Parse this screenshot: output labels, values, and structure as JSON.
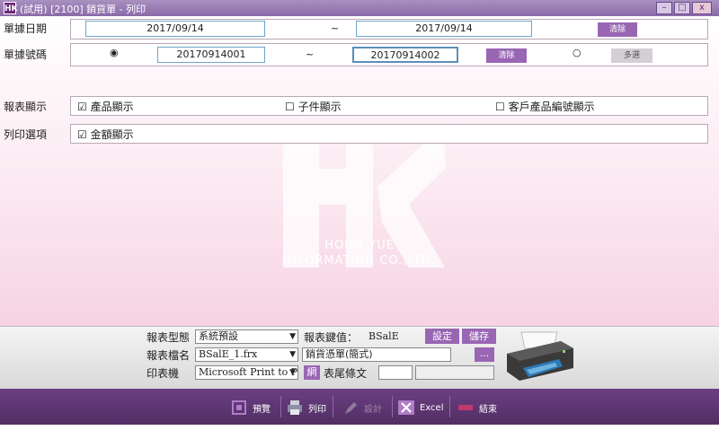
{
  "window": {
    "logo": "HK",
    "title": "(試用) [2100] 銷貨單 - 列印",
    "buttons": {
      "minimize": "–",
      "maximize": "□",
      "close": "x"
    }
  },
  "date_row": {
    "label": "單據日期",
    "from": "2017/09/14",
    "separator": "~",
    "to": "2017/09/14",
    "clear_label": "清除"
  },
  "number_row": {
    "label": "單據號碼",
    "radio_range": "◉",
    "from": "20170914001",
    "separator": "~",
    "to": "20170914002",
    "clear_label": "清除",
    "radio_multi": "○",
    "multi_label": "多選"
  },
  "display_row": {
    "label": "報表顯示",
    "options": [
      {
        "mark": "☑",
        "text": "產品顯示"
      },
      {
        "mark": "☐",
        "text": "子件顯示"
      },
      {
        "mark": "☐",
        "text": "客戶產品編號顯示"
      }
    ]
  },
  "print_row": {
    "label": "列印選項",
    "options": [
      {
        "mark": "☑",
        "text": "金額顯示"
      }
    ]
  },
  "watermark": {
    "line1": "HONG YUE",
    "line2": "INFORMATION CO.,LTD."
  },
  "settings": {
    "report_type_label": "報表型態",
    "report_type_value": "系統預設",
    "report_key_label": "報表鍵值：",
    "report_key_value": "BSalE",
    "setup_button": "設定",
    "save_button": "儲存",
    "report_file_label": "報表檔名",
    "report_file_value": "BSalE_1.frx",
    "report_name_value": "銷貨憑單(簡式)",
    "browse_button": "...",
    "printer_label": "印表機",
    "printer_value": "Microsoft Print to PI",
    "net_button": "網",
    "footer_text_label": "表尾條文"
  },
  "toolbar": {
    "preview": "預覽",
    "print": "列印",
    "design": "設計",
    "excel": "Excel",
    "exit": "結束"
  },
  "colors": {
    "accent": "#9966b3",
    "toolbar": "#5d3572",
    "field_border": "#6fa4c9"
  }
}
